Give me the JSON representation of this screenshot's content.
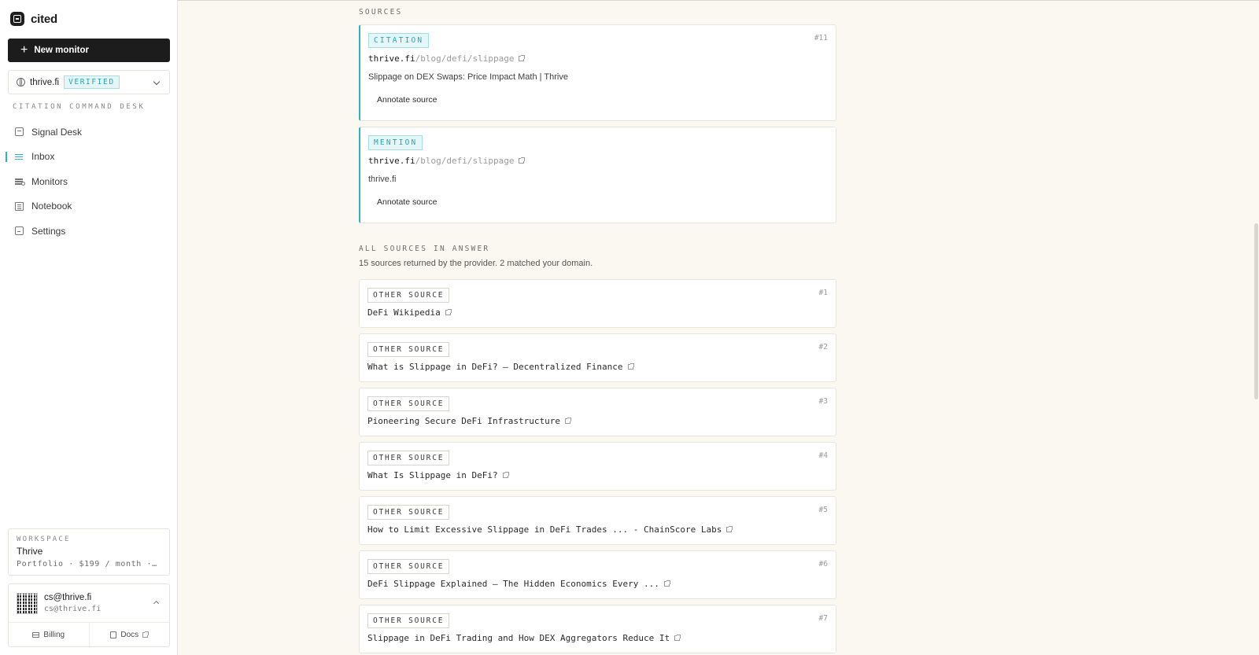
{
  "brand": {
    "name": "cited"
  },
  "sidebar": {
    "new_monitor_label": "New monitor",
    "domain": {
      "name": "thrive.fi",
      "badge": "VERIFIED"
    },
    "section_label": "CITATION COMMAND DESK",
    "items": [
      {
        "label": "Signal Desk",
        "icon": "desk-icon"
      },
      {
        "label": "Inbox",
        "icon": "inbox-icon",
        "active": true
      },
      {
        "label": "Monitors",
        "icon": "monitors-icon"
      },
      {
        "label": "Notebook",
        "icon": "notebook-icon"
      },
      {
        "label": "Settings",
        "icon": "settings-icon"
      }
    ],
    "workspace": {
      "label": "WORKSPACE",
      "name": "Thrive",
      "plan": "Portfolio · $199 / month · A..."
    },
    "user": {
      "email": "cs@thrive.fi",
      "sub": "cs@thrive.fi",
      "billing_label": "Billing",
      "docs_label": "Docs"
    }
  },
  "main": {
    "sources_heading": "SOURCES",
    "matched": [
      {
        "badge": "CITATION",
        "num": "#11",
        "domain": "thrive.fi",
        "path": "/blog/defi/slippage",
        "title": "Slippage on DEX Swaps: Price Impact Math | Thrive",
        "action": "Annotate source"
      },
      {
        "badge": "MENTION",
        "num": "",
        "domain": "thrive.fi",
        "path": "/blog/defi/slippage",
        "title": "thrive.fi",
        "action": "Annotate source"
      }
    ],
    "all_heading": "ALL SOURCES IN ANSWER",
    "all_sub": "15 sources returned by the provider. 2 matched your domain.",
    "others": [
      {
        "badge": "OTHER SOURCE",
        "num": "#1",
        "title": "DeFi Wikipedia"
      },
      {
        "badge": "OTHER SOURCE",
        "num": "#2",
        "title": "What is Slippage in DeFi? — Decentralized Finance"
      },
      {
        "badge": "OTHER SOURCE",
        "num": "#3",
        "title": "Pioneering Secure DeFi Infrastructure"
      },
      {
        "badge": "OTHER SOURCE",
        "num": "#4",
        "title": "What Is Slippage in DeFi?"
      },
      {
        "badge": "OTHER SOURCE",
        "num": "#5",
        "title": "How to Limit Excessive Slippage in DeFi Trades ... - ChainScore Labs"
      },
      {
        "badge": "OTHER SOURCE",
        "num": "#6",
        "title": "DeFi Slippage Explained – The Hidden Economics Every ..."
      },
      {
        "badge": "OTHER SOURCE",
        "num": "#7",
        "title": "Slippage in DeFi Trading and How DEX Aggregators Reduce It"
      }
    ]
  },
  "colors": {
    "accent": "#2bb3c0",
    "background": "#fbf8f1",
    "dark": "#1c1c1c"
  }
}
